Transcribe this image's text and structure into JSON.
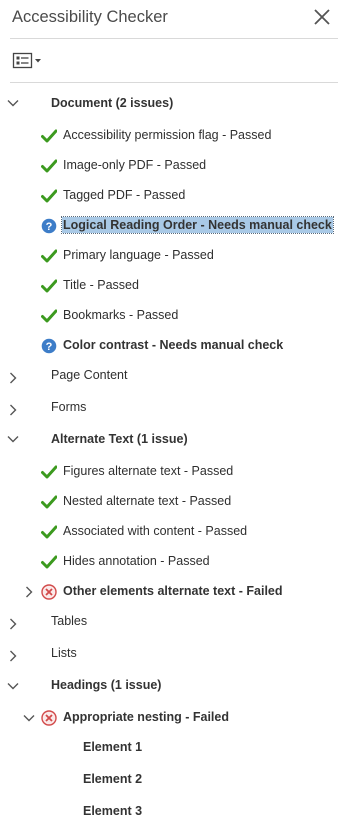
{
  "panel": {
    "title": "Accessibility Checker"
  },
  "icons": {
    "close": "close-icon",
    "options": "options-menu-icon",
    "passed": "checkmark-icon",
    "manual": "question-icon",
    "failed": "error-icon",
    "collapsed": "chevron-right-icon",
    "expanded": "chevron-down-icon"
  },
  "colors": {
    "passed": "#3c9a1f",
    "manual": "#3d7dc8",
    "failed": "#d24a4a",
    "selection": "#a9c9e6"
  },
  "tree": [
    {
      "label": "Document (2 issues)"
    },
    {
      "label": "Accessibility permission flag - Passed"
    },
    {
      "label": "Image-only PDF - Passed"
    },
    {
      "label": "Tagged PDF - Passed"
    },
    {
      "label": "Logical Reading Order - Needs manual check"
    },
    {
      "label": "Primary language - Passed"
    },
    {
      "label": "Title - Passed"
    },
    {
      "label": "Bookmarks - Passed"
    },
    {
      "label": "Color contrast - Needs manual check"
    },
    {
      "label": "Page Content"
    },
    {
      "label": "Forms"
    },
    {
      "label": "Alternate Text (1 issue)"
    },
    {
      "label": "Figures alternate text - Passed"
    },
    {
      "label": "Nested alternate text - Passed"
    },
    {
      "label": "Associated with content - Passed"
    },
    {
      "label": "Hides annotation - Passed"
    },
    {
      "label": "Other elements alternate text - Failed"
    },
    {
      "label": "Tables"
    },
    {
      "label": "Lists"
    },
    {
      "label": "Headings (1 issue)"
    },
    {
      "label": "Appropriate nesting - Failed"
    },
    {
      "label": "Element 1"
    },
    {
      "label": "Element 2"
    },
    {
      "label": "Element 3"
    }
  ]
}
